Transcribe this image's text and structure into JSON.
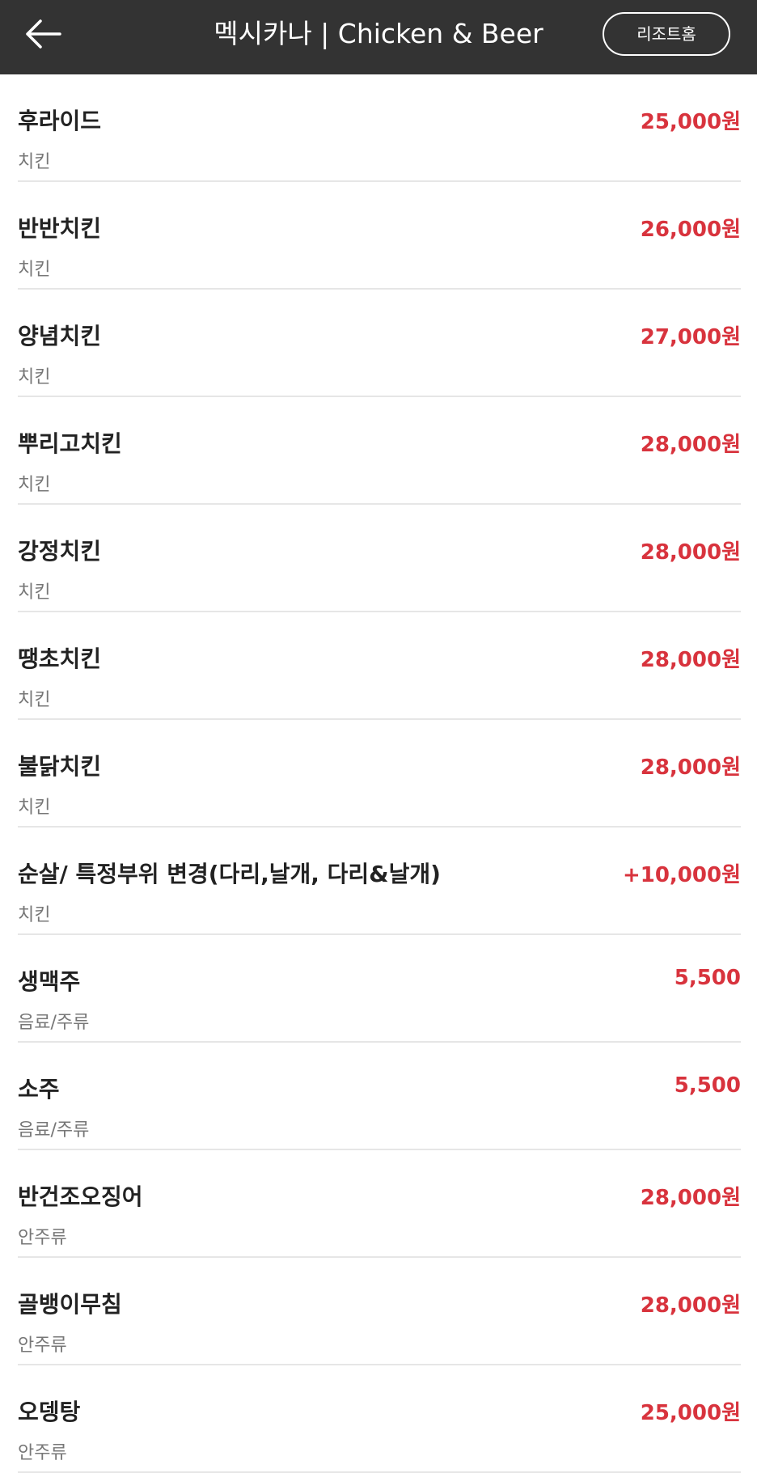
{
  "header": {
    "title": "멕시카나 | Chicken & Beer",
    "home_button": "리조트홈",
    "back_icon": "arrow-left-icon"
  },
  "colors": {
    "header_bg": "#333333",
    "price": "#d8333d",
    "category": "#777777",
    "divider": "#e6e6e6"
  },
  "menu": [
    {
      "name": "후라이드",
      "category": "치킨",
      "price": "25,000원"
    },
    {
      "name": "반반치킨",
      "category": "치킨",
      "price": "26,000원"
    },
    {
      "name": "양념치킨",
      "category": "치킨",
      "price": "27,000원"
    },
    {
      "name": "뿌리고치킨",
      "category": "치킨",
      "price": "28,000원"
    },
    {
      "name": "강정치킨",
      "category": "치킨",
      "price": "28,000원"
    },
    {
      "name": "땡초치킨",
      "category": "치킨",
      "price": "28,000원"
    },
    {
      "name": "불닭치킨",
      "category": "치킨",
      "price": "28,000원"
    },
    {
      "name": "순살/ 특정부위 변경(다리,날개, 다리&날개)",
      "category": "치킨",
      "price": "+10,000원"
    },
    {
      "name": "생맥주",
      "category": "음료/주류",
      "price": "5,500"
    },
    {
      "name": "소주",
      "category": "음료/주류",
      "price": "5,500"
    },
    {
      "name": "반건조오징어",
      "category": "안주류",
      "price": "28,000원"
    },
    {
      "name": "골뱅이무침",
      "category": "안주류",
      "price": "28,000원"
    },
    {
      "name": "오뎅탕",
      "category": "안주류",
      "price": "25,000원"
    }
  ]
}
